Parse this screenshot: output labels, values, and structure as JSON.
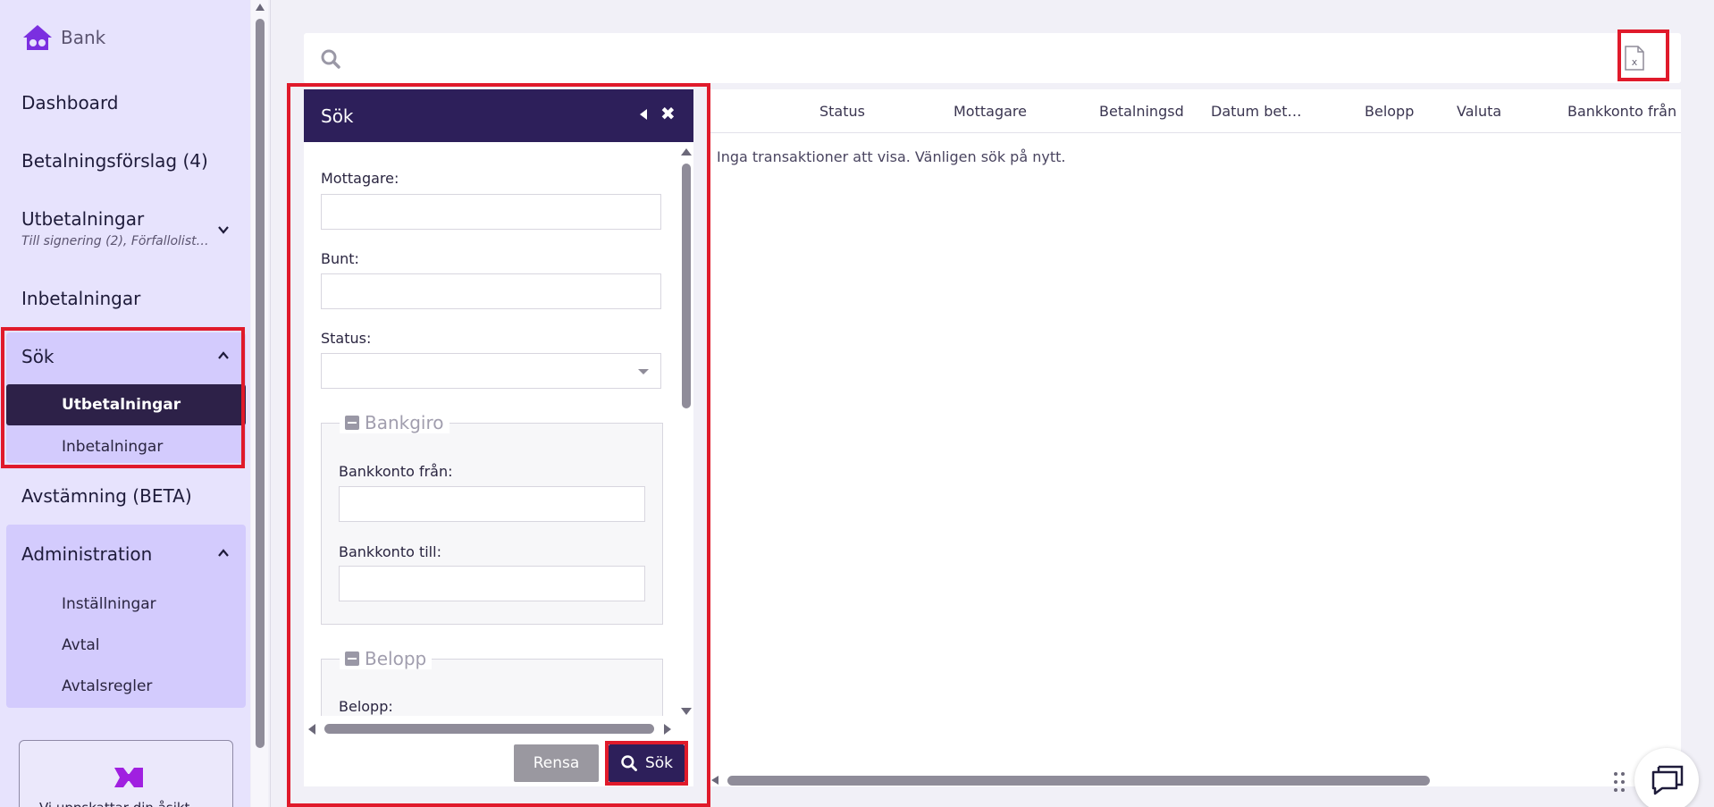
{
  "app": {
    "logo_text": "Bank"
  },
  "sidebar": {
    "items": [
      {
        "label": "Dashboard"
      },
      {
        "label": "Betalningsförslag (4)"
      },
      {
        "label": "Utbetalningar",
        "sublabel": "Till signering (2), Förfallolist…"
      },
      {
        "label": "Inbetalningar"
      },
      {
        "label": "Sök",
        "children": [
          "Utbetalningar",
          "Inbetalningar"
        ],
        "active_child": "Utbetalningar"
      },
      {
        "label": "Avstämning (BETA)"
      },
      {
        "label": "Administration",
        "children": [
          "Inställningar",
          "Avtal",
          "Avtalsregler"
        ]
      }
    ],
    "promo_text": "Vi uppskattar din åsikt"
  },
  "search_panel": {
    "title": "Sök",
    "fields": {
      "mottagare_label": "Mottagare:",
      "bunt_label": "Bunt:",
      "status_label": "Status:",
      "status_value": ""
    },
    "bankgiro": {
      "legend": "Bankgiro",
      "from_label": "Bankkonto från:",
      "to_label": "Bankkonto till:"
    },
    "belopp": {
      "legend": "Belopp",
      "label": "Belopp:"
    },
    "clear_button": "Rensa",
    "search_button": "Sök"
  },
  "table": {
    "columns": [
      "Status",
      "Mottagare",
      "Betalningsdatum",
      "Datum bet…",
      "Belopp",
      "Valuta",
      "Bankkonto från"
    ],
    "empty_message": "Inga transaktioner att visa. Vänligen sök på nytt."
  },
  "colors": {
    "brand_purple": "#2d1f5a",
    "sidebar_bg": "#e7e3fd",
    "sidebar_group_bg": "#d3cbfd",
    "highlight_red": "#e01a2b",
    "logo_purple": "#7b2fe0"
  },
  "icons": {
    "search": "search-icon",
    "excel_export": "excel-file-icon",
    "chat": "chat-icon"
  }
}
